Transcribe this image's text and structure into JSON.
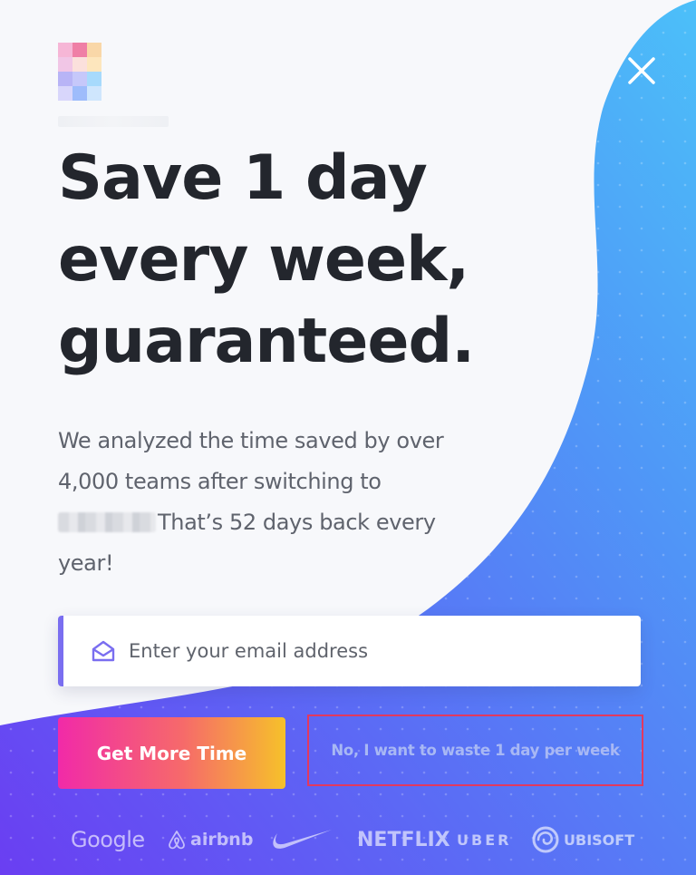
{
  "dialog": {
    "headline_lines": [
      "Save 1 day",
      "every week,",
      "guaranteed."
    ],
    "subtext_part1": "We analyzed the time saved by over 4,000 teams after switching to",
    "subtext_part2": "That’s 52 days back every year!",
    "email": {
      "placeholder": "Enter your email address",
      "value": ""
    },
    "cta_label": "Get More Time",
    "decline_label": "No, I want to waste 1 day per week"
  },
  "brands": [
    "Google",
    "airbnb",
    "NETFLIX",
    "UBER",
    "UBISOFT"
  ],
  "icons": {
    "close": "close-icon",
    "mail": "mail-open-icon",
    "nike": "nike-swoosh-logo",
    "airbnb": "airbnb-belo-logo",
    "ubisoft": "ubisoft-swirl-logo"
  },
  "colors": {
    "headline": "#23262d",
    "body_text": "#5f636d",
    "accent_purple": "#7a6ef0",
    "blue_gradient_start": "#5b6bf5",
    "blue_gradient_end": "#4cb8f8",
    "cta_gradient": [
      "#f12aa8",
      "#f66a6a",
      "#f6c12a"
    ],
    "decline_border": "#e2395f",
    "decline_text": "#a8b8f4"
  }
}
